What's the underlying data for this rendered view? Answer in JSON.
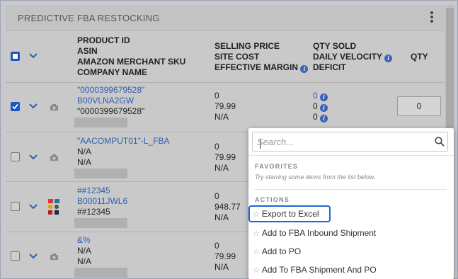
{
  "panel": {
    "title": "PREDICTIVE FBA RESTOCKING"
  },
  "table": {
    "header": {
      "col_product": [
        "PRODUCT ID",
        "ASIN",
        "AMAZON MERCHANT SKU",
        "COMPANY NAME"
      ],
      "col_price": [
        "SELLING PRICE",
        "SITE COST",
        "EFFECTIVE MARGIN"
      ],
      "col_qty_sold": [
        "QTY SOLD",
        "DAILY VELOCITY",
        "DEFICIT"
      ],
      "col_qty": "QTY"
    },
    "rows": [
      {
        "checked": true,
        "product_id": "\"0000399679528\"",
        "asin": "B00VLNA2GW",
        "sku": "\"0000399679528\"",
        "price": "0",
        "cost": "79.99",
        "margin": "N/A",
        "qty_sold": "0",
        "velocity": "0",
        "deficit": "0",
        "qty": "0"
      },
      {
        "checked": false,
        "product_id": "\"AACOMPUT01\"-L_FBA",
        "asin": "N/A",
        "sku": "N/A",
        "price": "0",
        "cost": "79.99",
        "margin": "N/A"
      },
      {
        "checked": false,
        "product_id": "##12345",
        "asin": "B00011JWL6",
        "sku": "##12345",
        "price": "0",
        "cost": "948.77",
        "margin": "N/A"
      },
      {
        "checked": false,
        "product_id": "&%",
        "asin": "N/A",
        "sku": "N/A",
        "price": "0",
        "cost": "79.99",
        "margin": "N/A"
      }
    ]
  },
  "dropdown": {
    "search_placeholder": "Search...",
    "favorites_title": "FAVORITES",
    "favorites_hint": "Try starring some items from the list below.",
    "actions_title": "ACTIONS",
    "items": [
      "Export to Excel",
      "Add to FBA Inbound Shipment",
      "Add to PO",
      "Add To FBA Shipment And PO"
    ]
  },
  "colors": {
    "accent": "#1a56c4",
    "link": "#2e5fb3",
    "highlight": "#1f66d8"
  }
}
